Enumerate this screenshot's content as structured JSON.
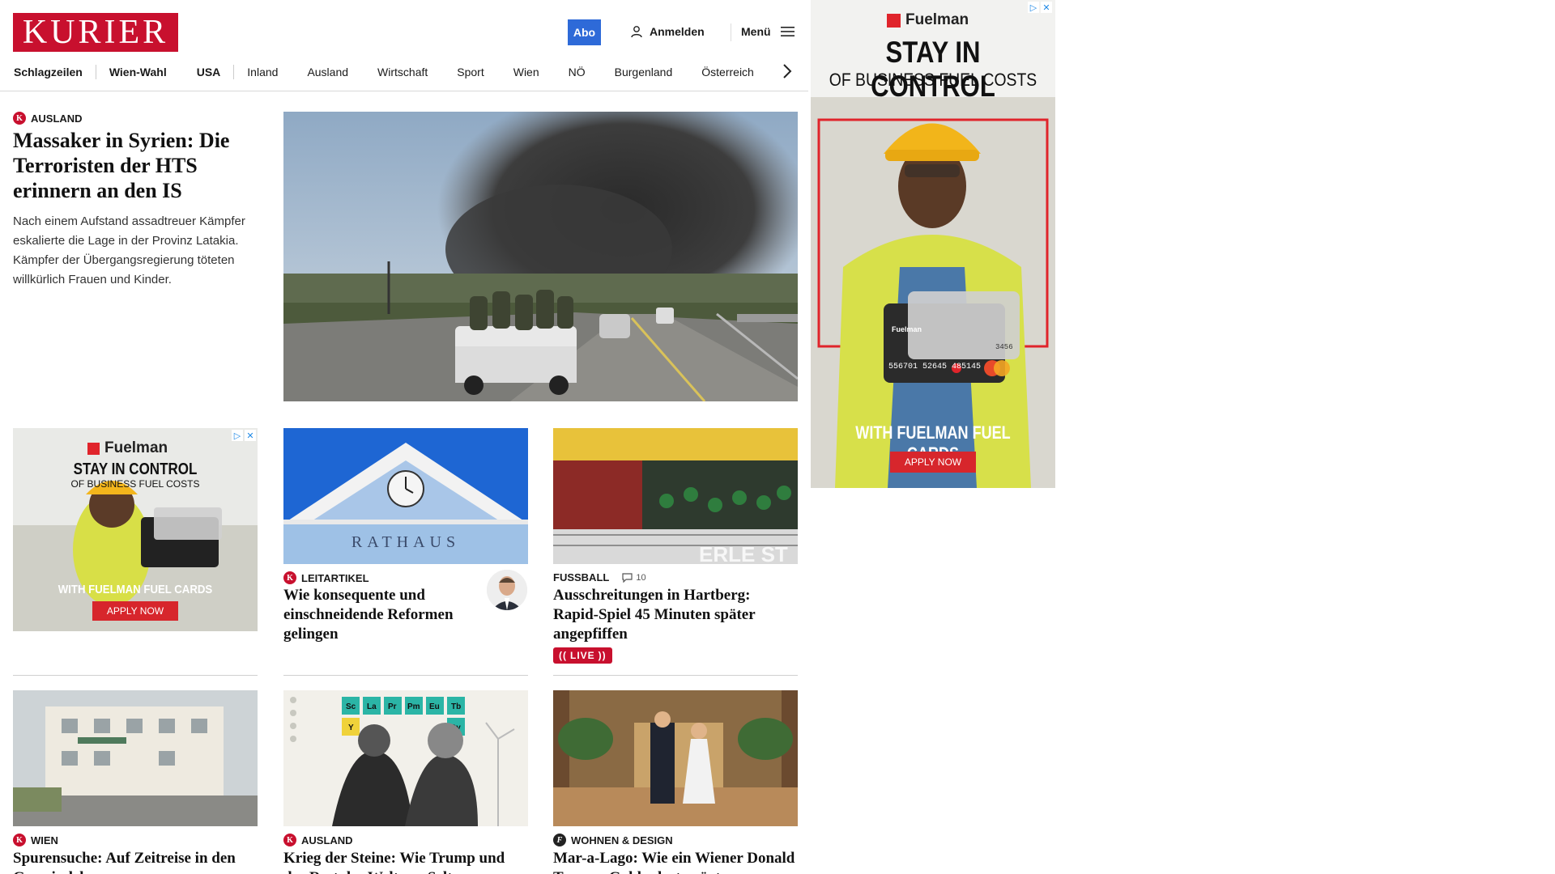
{
  "header": {
    "logo_text": "KURIER",
    "abo_label": "Abo",
    "login_label": "Anmelden",
    "menu_label": "Menü"
  },
  "nav": {
    "items": [
      "Schlagzeilen",
      "Wien-Wahl",
      "USA",
      "Inland",
      "Ausland",
      "Wirtschaft",
      "Sport",
      "Wien",
      "NÖ",
      "Burgenland",
      "Österreich"
    ]
  },
  "lead": {
    "kicker": "AUSLAND",
    "title": "Massaker in Syrien: Die Terroristen der HTS erinnern an den IS",
    "teaser": "Nach einem Aufstand assadtreuer Kämpfer eskalierte die Lage in der Provinz Latakia. Kämpfer der Übergangsregierung töteten willkürlich Frauen und Kinder."
  },
  "cards_row1": [
    {
      "kicker": "LEITARTIKEL",
      "title": "Wie konsequente und einschneidende Reformen gelingen",
      "image_caption": "RATHAUS"
    },
    {
      "kicker": "FUSSBALL",
      "comments": "10",
      "title": "Ausschreitungen in Hartberg: Rapid-Spiel 45 Minuten später angepfiffen",
      "live_label": "LIVE"
    }
  ],
  "cards_row2": [
    {
      "kicker": "WIEN",
      "title": "Spurensuche: Auf Zeitreise in den Gemeindebau"
    },
    {
      "kicker": "AUSLAND",
      "title": "Krieg der Steine: Wie Trump und der Rest der Welt um Seltene"
    },
    {
      "kicker": "WOHNEN & DESIGN",
      "title": "Mar-a-Lago: Wie ein Wiener Donald Trumps Goldpalast prägte"
    }
  ],
  "ad": {
    "brand": "Fuelman",
    "headline": "STAY IN CONTROL",
    "subline": "OF BUSINESS FUEL COSTS",
    "cta_line": "WITH FUELMAN FUEL CARDS",
    "button": "APPLY NOW",
    "card_number": "556701 52645 485145",
    "card_last": "3456"
  },
  "colors": {
    "brand_red": "#c8102e",
    "abo_blue": "#2e6ad8",
    "ad_red": "#e0242b"
  }
}
